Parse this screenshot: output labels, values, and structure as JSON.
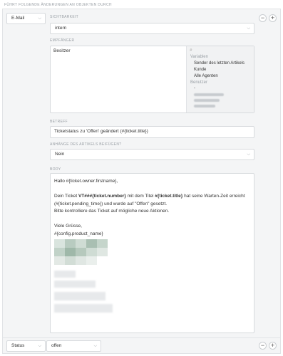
{
  "header": "FÜHRT FOLGENDE ÄNDERUNGEN AN OBJEKTEN DURCH",
  "row1": {
    "type_label": "E-Mail",
    "sichtbarkeit": {
      "label": "SICHTBARKEIT",
      "value": "intern"
    },
    "empfaenger": {
      "label": "EMPFÄNGER",
      "selected": "Besitzer",
      "groups": [
        {
          "title": "Variablen",
          "items": [
            "Sender des letzten Artikels",
            "Kunde",
            "Alle Agenten"
          ]
        },
        {
          "title": "Benutzer",
          "items": [
            "-"
          ]
        }
      ]
    },
    "betreff": {
      "label": "BETREFF",
      "value": "Ticketstatus zu 'Offen' geändert (#{ticket.title})"
    },
    "anhaenge": {
      "label": "ANHÄNGE DES ARTIKELS BEIFÜGEN?",
      "value": "Nein"
    },
    "body": {
      "label": "BODY",
      "greeting": "Hallo #{ticket.owner.firstname},",
      "line1_a": "Dein Ticket ",
      "line1_b": "VT###{ticket.number}",
      "line1_c": " mit dem Titel ",
      "line1_d": "#{ticket.title}",
      "line1_e": " hat seine Warten-Zeit erreicht",
      "line2": "(#{ticket.pending_time}) und wurde auf \"Offen\" gesetzt.",
      "line3": "Bitte kontrolliere das Ticket auf mögliche neue Aktionen.",
      "closing": "Viele Grüsse,",
      "signature": "#{config.product_name}"
    }
  },
  "row2": {
    "type_label": "Status",
    "value": "offen"
  },
  "buttons": {
    "minus": "−",
    "plus": "+"
  },
  "colors": {
    "page_bg": "#ffffff",
    "panel_bg": "#f4f5f6",
    "border": "#d7dadd",
    "muted": "#9aa0a6"
  }
}
